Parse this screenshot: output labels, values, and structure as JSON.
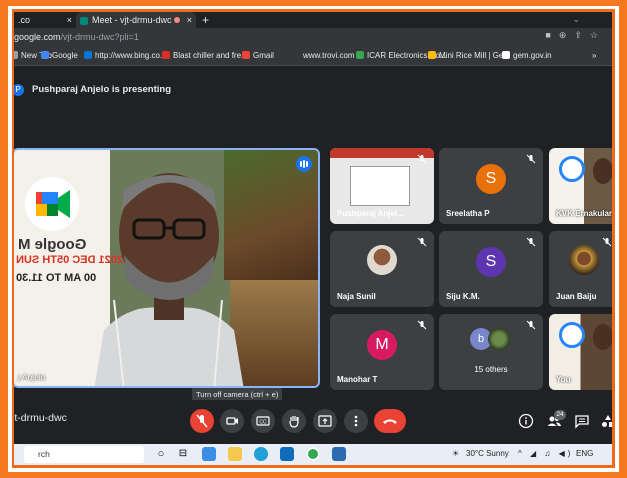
{
  "browser": {
    "tabs": [
      {
        "title": ".co",
        "close": "×"
      },
      {
        "title": "Meet - vjt-drmu-dwc",
        "close": "×"
      }
    ],
    "new_tab": "+",
    "url_host": "google.com",
    "url_path": "/vjt-drmu-dwc?pli=1"
  },
  "bookmarks": [
    {
      "label": "New Tab",
      "icon": "tab-icon",
      "color": "#9aa0a6"
    },
    {
      "label": "Google",
      "icon": "google-icon",
      "color": "#4285f4"
    },
    {
      "label": "http://www.bing.co...",
      "icon": "bing-icon",
      "color": "#0078d4"
    },
    {
      "label": "Blast chiller and fre...",
      "icon": "pdf-icon",
      "color": "#d93025"
    },
    {
      "label": "Gmail",
      "icon": "gmail-icon",
      "color": "#ea4335"
    },
    {
      "label": "www.trovi.com",
      "icon": "page-icon",
      "color": "#35363a"
    },
    {
      "label": "ICAR Electronics Co...",
      "icon": "icar-icon",
      "color": "#34a853"
    },
    {
      "label": "Mini Rice Mill | GeM",
      "icon": "gem-icon",
      "color": "#fbbc04"
    },
    {
      "label": "gem.gov.in",
      "icon": "gem-gov-icon",
      "color": "#ffffff"
    }
  ],
  "bookmarks_more": "»",
  "presenting": {
    "avatar_letter": "P",
    "text": "Pushparaj Anjelo is presenting"
  },
  "main_tile": {
    "name": "j Anjelo",
    "slide_text_1": "Google M",
    "slide_text_2": "2021 DEC 05TH SUN",
    "slide_text_3": "00 AM TO 11.30"
  },
  "participants": [
    {
      "name": "Pushparaj Anjel...",
      "type": "screen"
    },
    {
      "name": "Sreelatha P",
      "type": "letter",
      "letter": "S",
      "color": "#e8710a"
    },
    {
      "name": "KVK Ernakulam",
      "type": "video"
    },
    {
      "name": "Naja Sunil",
      "type": "photo"
    },
    {
      "name": "Siju K.M.",
      "type": "letter",
      "letter": "S",
      "color": "#5e35b1"
    },
    {
      "name": "Juan Baiju",
      "type": "photo"
    },
    {
      "name": "Manohar T",
      "type": "letter",
      "letter": "M",
      "color": "#d81b60"
    },
    {
      "name": "15 others",
      "type": "others",
      "letter": "b"
    },
    {
      "name": "You",
      "type": "video"
    }
  ],
  "controls": {
    "meeting_code": "jt-drmu-dwc",
    "tooltip": "Turn off camera (ctrl + e)",
    "participant_count": "24"
  },
  "taskbar": {
    "search_placeholder": "rch",
    "weather": "30°C  Sunny",
    "language": "ENG"
  }
}
